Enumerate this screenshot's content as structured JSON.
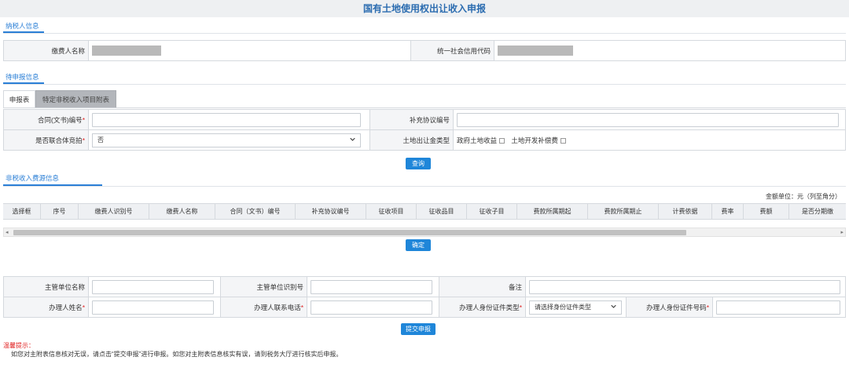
{
  "title": "国有土地使用权出让收入申报",
  "taxpayer": {
    "section_label": "纳税人信息",
    "payer_name_label": "缴费人名称",
    "credit_code_label": "统一社会信用代码"
  },
  "pending": {
    "section_label": "待申报信息",
    "tabs": [
      "申报表",
      "特定非税收入项目附表"
    ],
    "contract_no_label": "合同(文书)编号",
    "supplement_no_label": "补充协议编号",
    "joint_bid_label": "是否联合体竞拍",
    "joint_bid_value": "否",
    "fund_type_label": "土地出让金类型",
    "fund_type_options": [
      "政府土地收益",
      "土地开发补偿费"
    ],
    "query_button": "查询"
  },
  "source": {
    "section_label": "非税收入费源信息",
    "unit_note": "金额单位：元（列至角分）",
    "columns": [
      "选择框",
      "序号",
      "缴费人识别号",
      "缴费人名称",
      "合同（文书）编号",
      "补充协议编号",
      "征收项目",
      "征收品目",
      "征收子目",
      "费款所属期起",
      "费款所属期止",
      "计费依据",
      "费率",
      "费额",
      "是否分期缴"
    ],
    "confirm_button": "确定"
  },
  "handler": {
    "dept_name_label": "主管单位名称",
    "dept_id_label": "主管单位识别号",
    "remark_label": "备注",
    "person_name_label": "办理人姓名",
    "person_phone_label": "办理人联系电话",
    "id_type_label": "办理人身份证件类型",
    "id_type_placeholder": "请选择身份证件类型",
    "id_no_label": "办理人身份证件号码",
    "submit_button": "提交申报"
  },
  "tips": {
    "title": "温馨提示：",
    "text": "如您对主附表信息核对无误，请点击“提交申报”进行申报。如您对主附表信息核实有误，请到税务大厅进行核实后申报。"
  },
  "colors": {
    "accent": "#1f86d9",
    "required": "#e02020",
    "header_bg": "#eef0f2"
  }
}
